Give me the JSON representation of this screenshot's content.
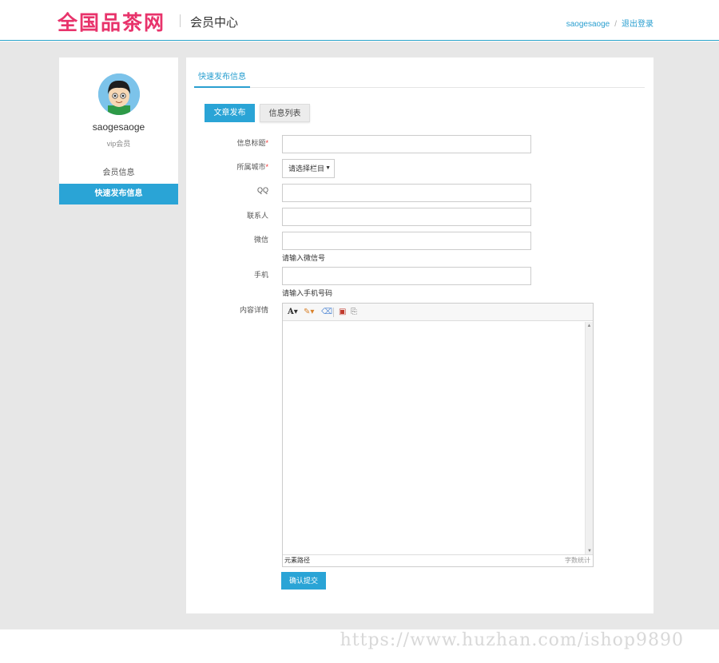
{
  "header": {
    "logo_text": "全国品茶网",
    "subtitle": "会员中心",
    "username_link": "saogesaoge",
    "separator": "/",
    "logout_link": "退出登录"
  },
  "sidebar": {
    "username": "saogesaoge",
    "level": "vip会员",
    "items": [
      {
        "label": "会员信息",
        "active": false
      },
      {
        "label": "快速发布信息",
        "active": true
      }
    ]
  },
  "panel": {
    "tab_label": "快速发布信息",
    "buttons": {
      "publish": "文章发布",
      "list": "信息列表"
    },
    "form": {
      "title_label": "信息标题",
      "city_label": "所属城市",
      "city_select_value": "请选择栏目",
      "qq_label": "QQ",
      "contact_label": "联系人",
      "wechat_label": "微信",
      "wechat_hint": "请输入微信号",
      "mobile_label": "手机",
      "mobile_hint": "请输入手机号码",
      "content_label": "内容详情",
      "required_mark": "*",
      "editor_status_left": "元素路径",
      "editor_status_right": "字数统计",
      "submit_label": "确认提交"
    }
  },
  "watermark": "https://www.huzhan.com/ishop9890",
  "colors": {
    "accent": "#2aa4d6",
    "logo": "#e8336b",
    "background": "#e7e7e7"
  }
}
